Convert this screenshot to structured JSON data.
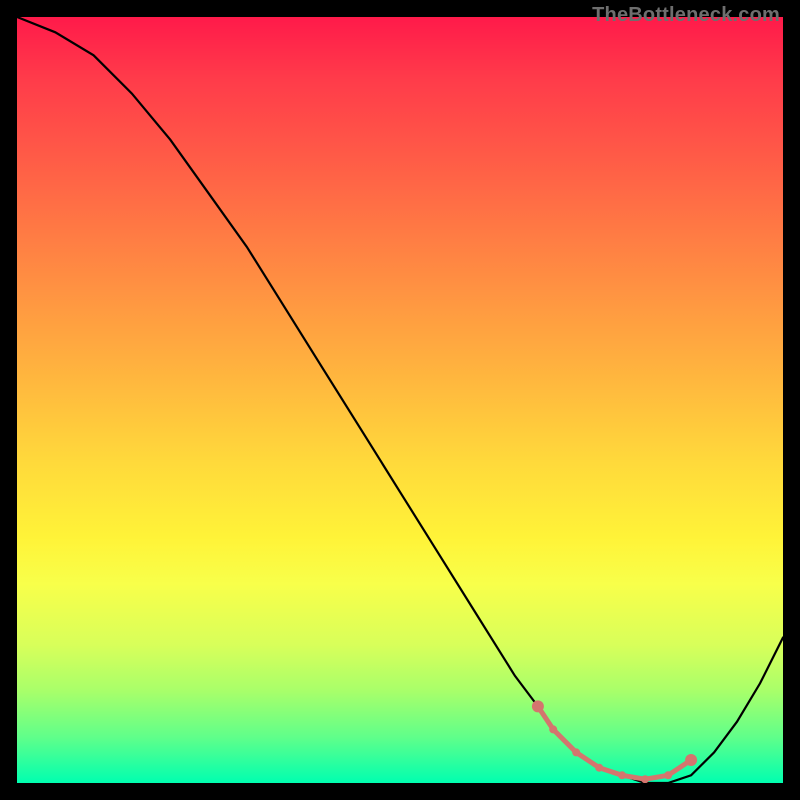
{
  "watermark": "TheBottleneck.com",
  "chart_data": {
    "type": "line",
    "title": "",
    "xlabel": "",
    "ylabel": "",
    "xlim": [
      0,
      100
    ],
    "ylim": [
      0,
      100
    ],
    "series": [
      {
        "name": "bottleneck-curve",
        "x": [
          0,
          5,
          10,
          15,
          20,
          25,
          30,
          35,
          40,
          45,
          50,
          55,
          60,
          65,
          68,
          70,
          73,
          76,
          79,
          82,
          85,
          88,
          91,
          94,
          97,
          100
        ],
        "y": [
          100,
          98,
          95,
          90,
          84,
          77,
          70,
          62,
          54,
          46,
          38,
          30,
          22,
          14,
          10,
          7,
          4,
          2,
          1,
          0,
          0,
          1,
          4,
          8,
          13,
          19
        ]
      }
    ],
    "highlight_range": {
      "name": "optimal-zone",
      "points": [
        {
          "x": 68,
          "y": 10
        },
        {
          "x": 70,
          "y": 7
        },
        {
          "x": 73,
          "y": 4
        },
        {
          "x": 76,
          "y": 2
        },
        {
          "x": 79,
          "y": 1
        },
        {
          "x": 82,
          "y": 0.5
        },
        {
          "x": 85,
          "y": 1
        },
        {
          "x": 88,
          "y": 3
        }
      ]
    },
    "colors": {
      "gradient_top": "#ff1a4a",
      "gradient_bottom": "#00ffb0",
      "curve": "#000000",
      "highlight": "#d4756e"
    }
  }
}
